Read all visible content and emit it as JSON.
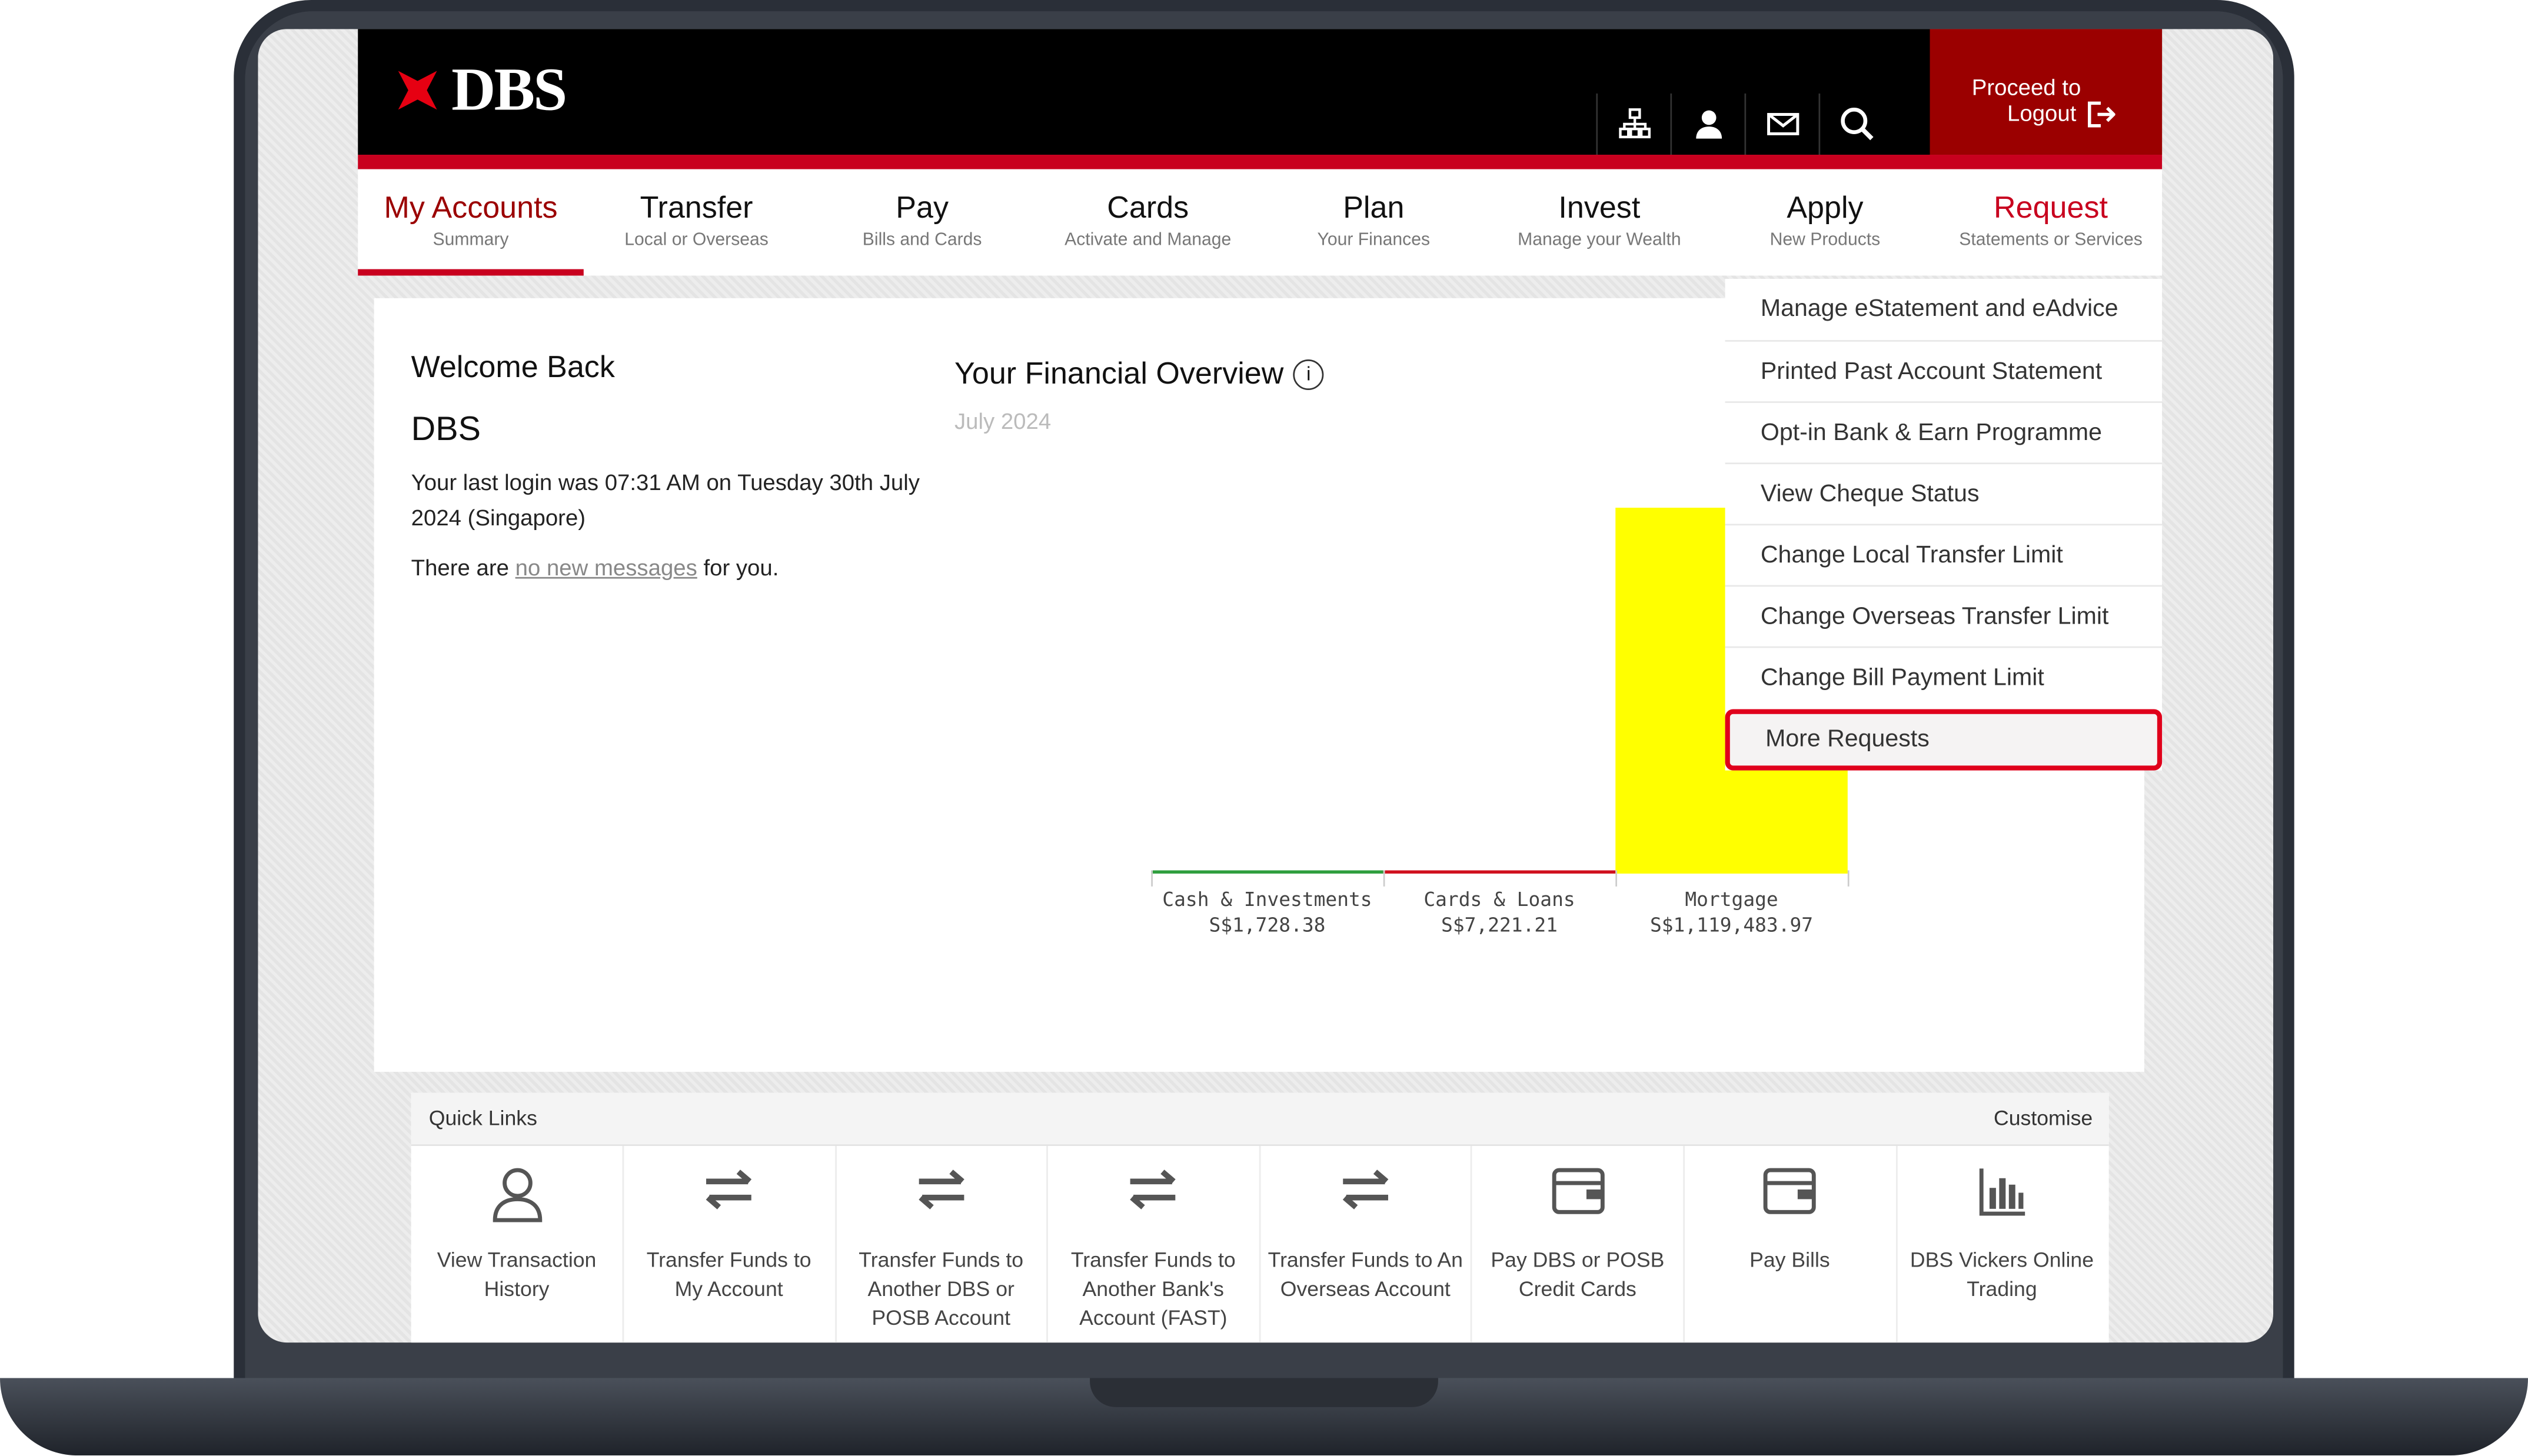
{
  "header": {
    "logo_text": "DBS",
    "logout_line1": "Proceed to",
    "logout_line2": "Logout",
    "icons": [
      "sitemap-icon",
      "user-icon",
      "mail-icon",
      "search-icon"
    ]
  },
  "nav": [
    {
      "title": "My Accounts",
      "sub": "Summary"
    },
    {
      "title": "Transfer",
      "sub": "Local or Overseas"
    },
    {
      "title": "Pay",
      "sub": "Bills and Cards"
    },
    {
      "title": "Cards",
      "sub": "Activate and Manage"
    },
    {
      "title": "Plan",
      "sub": "Your Finances"
    },
    {
      "title": "Invest",
      "sub": "Manage your Wealth"
    },
    {
      "title": "Apply",
      "sub": "New Products"
    },
    {
      "title": "Request",
      "sub": "Statements or Services"
    }
  ],
  "welcome": {
    "greeting": "Welcome Back",
    "name": "DBS",
    "last_login": "Your last login was 07:31 AM on Tuesday 30th July 2024 (Singapore)",
    "msg_pre": "There are",
    "msg_link": "no new messages",
    "msg_post": "for you."
  },
  "overview": {
    "title": "Your Financial Overview",
    "info_glyph": "i",
    "date": "July 2024"
  },
  "chart_data": {
    "type": "bar",
    "categories": [
      "Cash & Investments",
      "Cards & Loans",
      "Mortgage"
    ],
    "values": [
      1728.38,
      7221.21,
      1119483.97
    ],
    "value_labels": [
      "S$1,728.38",
      "S$7,221.21",
      "S$1,119,483.97"
    ],
    "colors": [
      "#2e9e3e",
      "#d0101e",
      "#ffff00"
    ]
  },
  "request_menu": [
    "Manage eStatement and eAdvice",
    "Printed Past Account Statement",
    "Opt-in Bank & Earn Programme",
    "View Cheque Status",
    "Change Local Transfer Limit",
    "Change Overseas Transfer Limit",
    "Change Bill Payment Limit",
    "More Requests"
  ],
  "quick_links": {
    "title": "Quick Links",
    "customise": "Customise",
    "items": [
      {
        "label": "View Transaction History",
        "icon": "user-icon"
      },
      {
        "label": "Transfer Funds to My Account",
        "icon": "transfer-icon"
      },
      {
        "label": "Transfer Funds to Another DBS or POSB Account",
        "icon": "transfer-icon"
      },
      {
        "label": "Transfer Funds to Another Bank's Account (FAST)",
        "icon": "transfer-icon"
      },
      {
        "label": "Transfer Funds to An Overseas Account",
        "icon": "transfer-icon"
      },
      {
        "label": "Pay DBS or POSB Credit Cards",
        "icon": "wallet-icon"
      },
      {
        "label": "Pay Bills",
        "icon": "wallet-icon"
      },
      {
        "label": "DBS Vickers Online Trading",
        "icon": "bar-chart-icon"
      }
    ]
  }
}
